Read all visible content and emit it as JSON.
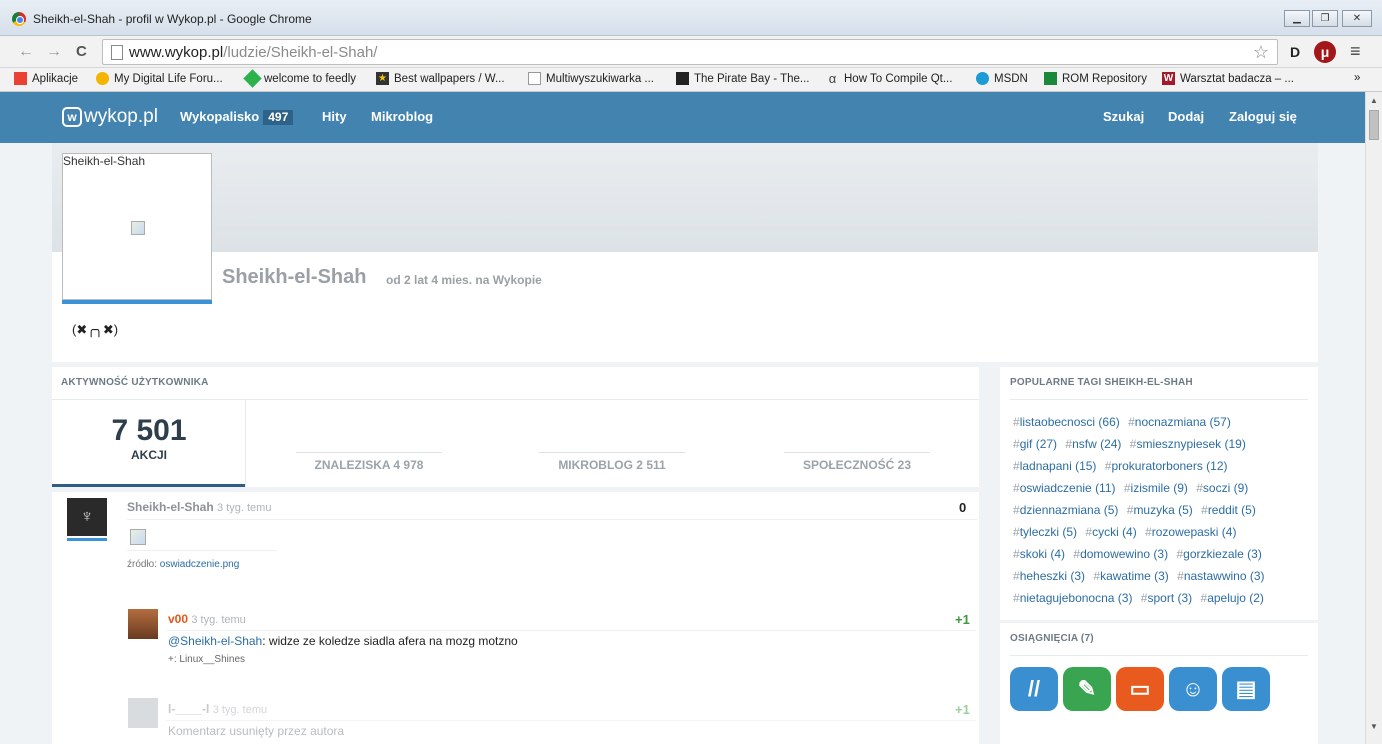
{
  "window": {
    "title": "Sheikh-el-Shah - profil w Wykop.pl - Google Chrome",
    "min": "▁",
    "max": "❐",
    "close": "✕"
  },
  "browser": {
    "url_host": "www.wykop.pl",
    "url_path": "/ludzie/Sheikh-el-Shah/",
    "back": "←",
    "forward": "→",
    "reload": "C",
    "star": "☆",
    "menu": "≡",
    "ext_d": "D",
    "ext_u": "μ"
  },
  "bookmarks": [
    {
      "label": "Aplikacje",
      "icon": "apps-grid-icon",
      "color": "#e94235"
    },
    {
      "label": "My Digital Life Foru...",
      "icon": "bulb-icon",
      "color": "#f4b400"
    },
    {
      "label": "welcome to feedly",
      "icon": "feedly-icon",
      "color": "#2bb24c"
    },
    {
      "label": "Best wallpapers / W...",
      "icon": "star-square-icon",
      "color": "#333"
    },
    {
      "label": "Multiwyszukiwarka ...",
      "icon": "page-icon",
      "color": "#999"
    },
    {
      "label": "The Pirate Bay - The...",
      "icon": "ship-icon",
      "color": "#222"
    },
    {
      "label": "How To Compile Qt...",
      "icon": "alpha-icon",
      "color": "#444"
    },
    {
      "label": "MSDN",
      "icon": "msdn-icon",
      "color": "#1c9bd6"
    },
    {
      "label": "ROM Repository",
      "icon": "table-icon",
      "color": "#1a8a3a"
    },
    {
      "label": "Warsztat badacza – ...",
      "icon": "w-icon",
      "color": "#a31b2b"
    }
  ],
  "bookmarks_more": "»",
  "site": {
    "logo": "wykop.pl",
    "nav": {
      "wykopalisko": "Wykopalisko",
      "wykopalisko_count": "497",
      "hity": "Hity",
      "mikroblog": "Mikroblog",
      "szukaj": "Szukaj",
      "dodaj": "Dodaj",
      "zaloguj": "Zaloguj się"
    }
  },
  "profile": {
    "avatar_alt": "Sheikh-el-Shah",
    "username": "Sheikh-el-Shah",
    "since": "od 2 lat 4 mies. na Wykopie",
    "emote": "(✖╭╮✖)"
  },
  "activity": {
    "header": "AKTYWNOŚĆ UŻYTKOWNIKA",
    "total": "7 501",
    "total_label": "AKCJI",
    "tabs": [
      "ZNALEZISKA 4 978",
      "MIKROBLOG 2 511",
      "SPOŁECZNOŚĆ 23"
    ]
  },
  "feed": {
    "post": {
      "author": "Sheikh-el-Shah",
      "ago": "3 tyg. temu",
      "score": "0",
      "source_label": "źródło:",
      "source_link": "oswiadczenie.png"
    },
    "comment1": {
      "author": "v00",
      "ago": "3 tyg. temu",
      "score": "+1",
      "mention": "@Sheikh-el-Shah",
      "text": ": widze ze koledze siadla afera na mozg motzno",
      "plus": "+: Linux__Shines"
    },
    "comment2": {
      "author": "l-____-l",
      "ago": "3 tyg. temu",
      "score": "+1",
      "text": "Komentarz usunięty przez autora"
    }
  },
  "sidebar": {
    "tags_header": "POPULARNE TAGI SHEIKH-EL-SHAH",
    "tags": [
      "listaobecnosci (66)",
      "nocnazmiana (57)",
      "gif (27)",
      "nsfw (24)",
      "smiesznypiesek (19)",
      "ladnapani (15)",
      "prokuratorboners (12)",
      "oswiadczenie (11)",
      "izismile (9)",
      "soczi (9)",
      "dziennazmiana (5)",
      "muzyka (5)",
      "reddit (5)",
      "tyleczki (5)",
      "cycki (4)",
      "rozowepaski (4)",
      "skoki (4)",
      "domowewino (3)",
      "gorzkiezale (3)",
      "heheszki (3)",
      "kawatime (3)",
      "nastawwino (3)",
      "nietagujebonocna (3)",
      "sport (3)",
      "apelujo (2)"
    ],
    "ach_header": "OSIĄGNIĘCIA (7)",
    "badges": [
      {
        "icon": "slashes-icon",
        "glyph": "//",
        "color": "#3a8fd0"
      },
      {
        "icon": "pen-icon",
        "glyph": "✎",
        "color": "#3aa550"
      },
      {
        "icon": "speech-bubble-icon",
        "glyph": "▭",
        "color": "#e85a1d"
      },
      {
        "icon": "face-icon",
        "glyph": "☺",
        "color": "#3a8fd0"
      },
      {
        "icon": "id-card-icon",
        "glyph": "▤",
        "color": "#3a8fd0"
      }
    ]
  }
}
